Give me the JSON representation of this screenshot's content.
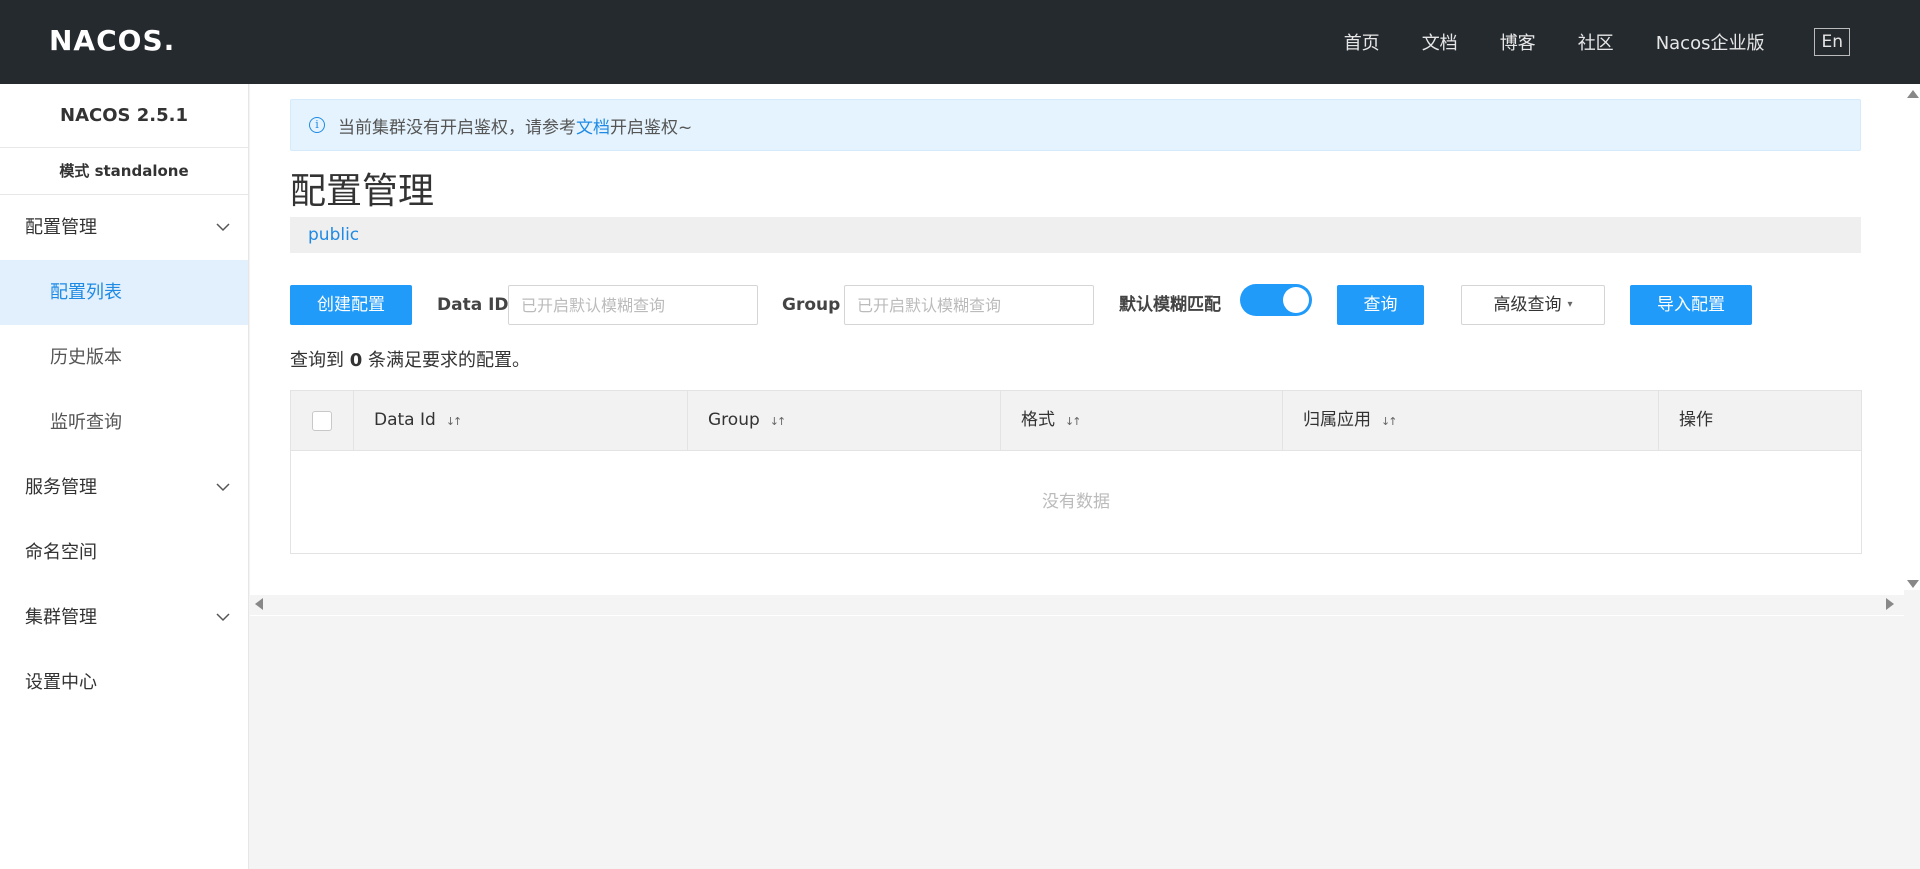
{
  "header": {
    "logo": "NACOS.",
    "nav": [
      "首页",
      "文档",
      "博客",
      "社区",
      "Nacos企业版"
    ],
    "lang": "En"
  },
  "sidebar": {
    "version": "NACOS 2.5.1",
    "mode": "模式 standalone",
    "items": [
      {
        "label": "配置管理",
        "expandable": true
      },
      {
        "label": "配置列表",
        "active": true
      },
      {
        "label": "历史版本"
      },
      {
        "label": "监听查询"
      },
      {
        "label": "服务管理",
        "expandable": true
      },
      {
        "label": "命名空间"
      },
      {
        "label": "集群管理",
        "expandable": true
      },
      {
        "label": "设置中心"
      }
    ]
  },
  "notice": {
    "text_before": "当前集群没有开启鉴权，请参考",
    "link": "文档",
    "text_after": "开启鉴权~"
  },
  "page": {
    "title": "配置管理",
    "namespace": "public"
  },
  "toolbar": {
    "create": "创建配置",
    "data_id_label": "Data ID",
    "data_id_placeholder": "已开启默认模糊查询",
    "group_label": "Group",
    "group_placeholder": "已开启默认模糊查询",
    "fuzzy_label": "默认模糊匹配",
    "fuzzy_on": true,
    "query": "查询",
    "advanced": "高级查询",
    "import": "导入配置"
  },
  "result": {
    "prefix": "查询到",
    "count": "0",
    "suffix": "条满足要求的配置。"
  },
  "table": {
    "columns": [
      "Data Id",
      "Group",
      "格式",
      "归属应用",
      "操作"
    ],
    "empty": "没有数据"
  },
  "colors": {
    "accent": "#209bfa",
    "header_bg": "#252a2f",
    "active_bg": "#e1f0fc"
  }
}
